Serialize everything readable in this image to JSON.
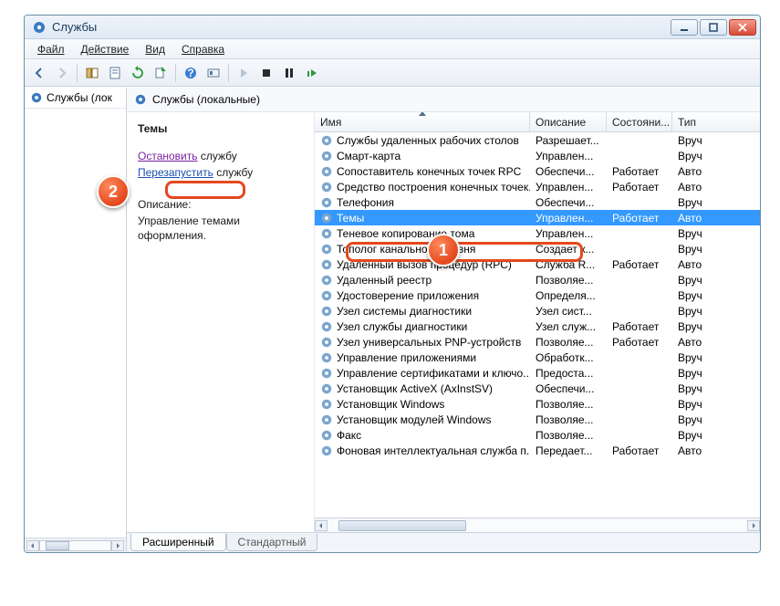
{
  "window": {
    "title": "Службы"
  },
  "menu": {
    "file": "Файл",
    "action": "Действие",
    "view": "Вид",
    "help": "Справка"
  },
  "left": {
    "title": "Службы (лок"
  },
  "right": {
    "header": "Службы (локальные)"
  },
  "detail": {
    "service_name": "Темы",
    "stop_action": "Остановить",
    "stop_suffix": " службу",
    "restart_action": "Перезапустить",
    "restart_suffix": " службу",
    "desc_label": "Описание:",
    "desc_text": "Управление темами оформления."
  },
  "columns": {
    "name": "Имя",
    "desc": "Описание",
    "state": "Состояни...",
    "type": "Тип"
  },
  "tabs": {
    "extended": "Расширенный",
    "standard": "Стандартный"
  },
  "markers": {
    "m1": "1",
    "m2": "2"
  },
  "services": [
    {
      "name": "Службы удаленных рабочих столов",
      "desc": "Разрешает...",
      "state": "",
      "type": "Вруч"
    },
    {
      "name": "Смарт-карта",
      "desc": "Управлен...",
      "state": "",
      "type": "Вруч"
    },
    {
      "name": "Сопоставитель конечных точек RPC",
      "desc": "Обеспечи...",
      "state": "Работает",
      "type": "Авто"
    },
    {
      "name": "Средство построения конечных точек...",
      "desc": "Управлен...",
      "state": "Работает",
      "type": "Авто"
    },
    {
      "name": "Телефония",
      "desc": "Обеспечи...",
      "state": "",
      "type": "Вруч"
    },
    {
      "name": "Темы",
      "desc": "Управлен...",
      "state": "Работает",
      "type": "Авто",
      "selected": true
    },
    {
      "name": "Теневое копирование тома",
      "desc": "Управлен...",
      "state": "",
      "type": "Вруч"
    },
    {
      "name": "Тополог канального уровня",
      "desc": "Создает к...",
      "state": "",
      "type": "Вруч"
    },
    {
      "name": "Удаленный вызов процедур (RPC)",
      "desc": "Служба R...",
      "state": "Работает",
      "type": "Авто"
    },
    {
      "name": "Удаленный реестр",
      "desc": "Позволяе...",
      "state": "",
      "type": "Вруч"
    },
    {
      "name": "Удостоверение приложения",
      "desc": "Определя...",
      "state": "",
      "type": "Вруч"
    },
    {
      "name": "Узел системы диагностики",
      "desc": "Узел сист...",
      "state": "",
      "type": "Вруч"
    },
    {
      "name": "Узел службы диагностики",
      "desc": "Узел служ...",
      "state": "Работает",
      "type": "Вруч"
    },
    {
      "name": "Узел универсальных PNP-устройств",
      "desc": "Позволяе...",
      "state": "Работает",
      "type": "Авто"
    },
    {
      "name": "Управление приложениями",
      "desc": "Обработк...",
      "state": "",
      "type": "Вруч"
    },
    {
      "name": "Управление сертификатами и ключо...",
      "desc": "Предоста...",
      "state": "",
      "type": "Вруч"
    },
    {
      "name": "Установщик ActiveX (AxInstSV)",
      "desc": "Обеспечи...",
      "state": "",
      "type": "Вруч"
    },
    {
      "name": "Установщик Windows",
      "desc": "Позволяе...",
      "state": "",
      "type": "Вруч"
    },
    {
      "name": "Установщик модулей Windows",
      "desc": "Позволяе...",
      "state": "",
      "type": "Вруч"
    },
    {
      "name": "Факс",
      "desc": "Позволяе...",
      "state": "",
      "type": "Вруч"
    },
    {
      "name": "Фоновая интеллектуальная служба п...",
      "desc": "Передает...",
      "state": "Работает",
      "type": "Авто"
    }
  ]
}
